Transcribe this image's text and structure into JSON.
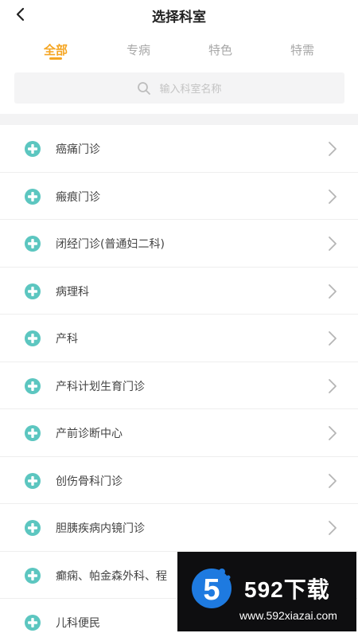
{
  "header": {
    "title": "选择科室",
    "back_icon": "chevron-left-icon"
  },
  "tabs": [
    {
      "label": "全部",
      "active": true
    },
    {
      "label": "专病",
      "active": false
    },
    {
      "label": "特色",
      "active": false
    },
    {
      "label": "特需",
      "active": false
    }
  ],
  "colors": {
    "accent": "#f5a623",
    "plus_icon": "#5cc6c0",
    "tab_inactive": "#a8a8a8",
    "watermark_blue": "#1e7ae0"
  },
  "search": {
    "placeholder": "输入科室名称",
    "icon": "search-icon"
  },
  "departments": [
    {
      "label": "癌痛门诊"
    },
    {
      "label": "瘢痕门诊"
    },
    {
      "label": "闭经门诊(普通妇二科)"
    },
    {
      "label": "病理科"
    },
    {
      "label": "产科"
    },
    {
      "label": "产科计划生育门诊"
    },
    {
      "label": "产前诊断中心"
    },
    {
      "label": "创伤骨科门诊"
    },
    {
      "label": "胆胰疾病内镜门诊"
    },
    {
      "label": "癫痫、帕金森外科、程"
    },
    {
      "label": "儿科便民"
    }
  ],
  "watermark": {
    "digit": "5",
    "brand": "592下载",
    "url": "www.592xiazai.com"
  }
}
